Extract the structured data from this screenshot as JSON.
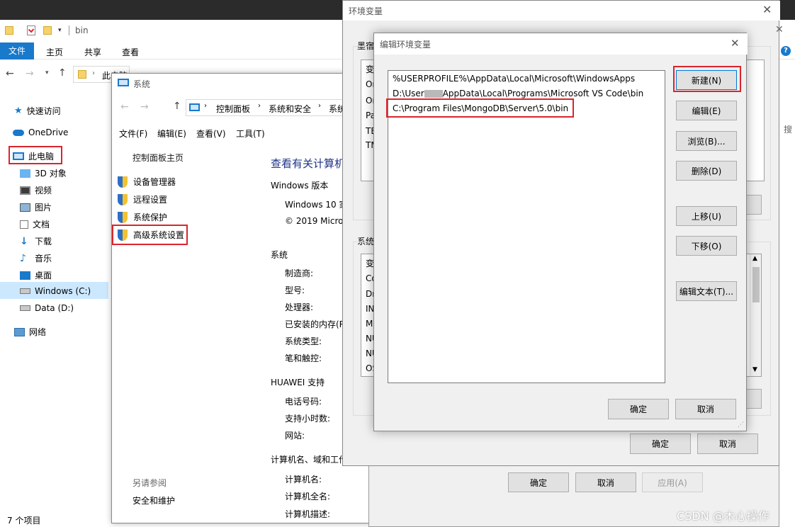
{
  "explorer": {
    "title": "bin",
    "ribbon_tabs": [
      "文件",
      "主页",
      "共享",
      "查看"
    ],
    "address_prefix": "此电脑",
    "nav": [
      {
        "label": "快速访问",
        "icon": "star-icon"
      },
      {
        "label": "OneDrive",
        "icon": "cloud-icon"
      },
      {
        "label": "此电脑",
        "icon": "computer-icon"
      },
      {
        "label": "3D 对象",
        "icon": "cube-icon"
      },
      {
        "label": "视频",
        "icon": "video-icon"
      },
      {
        "label": "图片",
        "icon": "picture-icon"
      },
      {
        "label": "文档",
        "icon": "document-icon"
      },
      {
        "label": "下载",
        "icon": "download-icon"
      },
      {
        "label": "音乐",
        "icon": "music-icon"
      },
      {
        "label": "桌面",
        "icon": "desktop-icon"
      },
      {
        "label": "Windows (C:)",
        "icon": "drive-icon"
      },
      {
        "label": "Data (D:)",
        "icon": "drive-icon"
      },
      {
        "label": "网络",
        "icon": "network-icon"
      }
    ],
    "status": "7 个项目",
    "search_partial": "搜"
  },
  "system": {
    "title": "系统",
    "address": [
      "控制面板",
      "系统和安全",
      "系统"
    ],
    "menu": [
      "文件(F)",
      "编辑(E)",
      "查看(V)",
      "工具(T)"
    ],
    "left_home": "控制面板主页",
    "left_links": [
      "设备管理器",
      "远程设置",
      "系统保护",
      "高级系统设置"
    ],
    "see_also": "另请参阅",
    "see_also_link": "安全和维护",
    "main_title": "查看有关计算机",
    "windows_edition_label": "Windows 版本",
    "windows_line1": "Windows 10 家",
    "windows_line2": "© 2019 Micro",
    "system_label": "系统",
    "system_rows": [
      "制造商:",
      "型号:",
      "处理器:",
      "已安装的内存(R",
      "系统类型:",
      "笔和触控:"
    ],
    "support_label": "HUAWEI 支持",
    "support_rows": [
      "电话号码:",
      "支持小时数:",
      "网站:"
    ],
    "computer_label": "计算机名、域和工作",
    "computer_rows": [
      "计算机名:",
      "计算机全名:",
      "计算机描述:"
    ]
  },
  "env": {
    "title": "环境变量",
    "user_group_partial": "墨宿",
    "user_items_partial": [
      "变",
      "On",
      "On",
      "Pa",
      "TE",
      "TM"
    ],
    "system_group_partial": "系统",
    "system_items_partial": [
      "变",
      "Co",
      "Dr",
      "IN",
      "M",
      "NU",
      "NU",
      "OS"
    ],
    "ok": "确定",
    "cancel": "取消"
  },
  "props": {
    "ok": "确定",
    "cancel": "取消",
    "apply": "应用(A)"
  },
  "edit": {
    "title": "编辑环境变量",
    "paths": [
      "%USERPROFILE%\\AppData\\Local\\Microsoft\\WindowsApps",
      "D:\\User",
      "AppData\\Local\\Programs\\Microsoft VS Code\\bin",
      "C:\\Program Files\\MongoDB\\Server\\5.0\\bin"
    ],
    "buttons": {
      "new": "新建(N)",
      "edit": "编辑(E)",
      "browse": "浏览(B)...",
      "delete": "删除(D)",
      "up": "上移(U)",
      "down": "下移(O)",
      "edit_text": "编辑文本(T)..."
    },
    "ok": "确定",
    "cancel": "取消"
  },
  "watermark": "CSDN @木心操作",
  "colors": {
    "accent": "#0063b1",
    "highlight_red": "#d8262d",
    "link_blue": "#0066cc"
  }
}
